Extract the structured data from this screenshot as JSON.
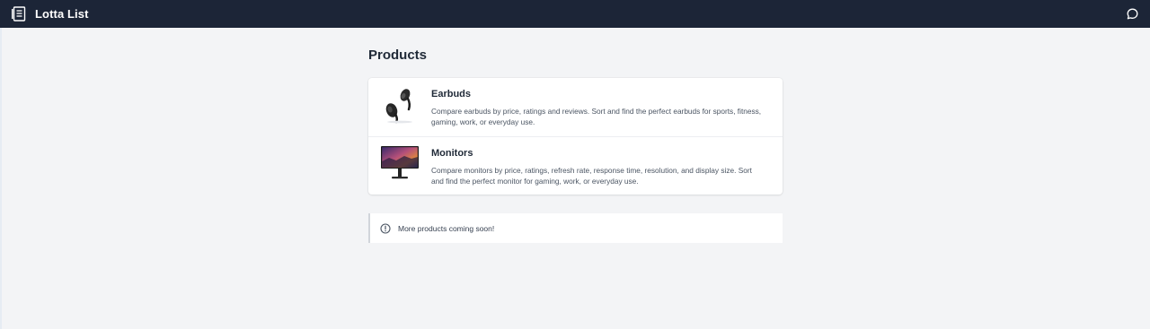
{
  "app": {
    "title": "Lotta List",
    "logo_icon": "list-document-icon",
    "chat_icon": "chat-bubble-icon"
  },
  "colors": {
    "topbar": "#1c2537",
    "background": "#f3f4f6",
    "card": "#ffffff"
  },
  "page": {
    "title": "Products"
  },
  "products": [
    {
      "title": "Earbuds",
      "description": "Compare earbuds by price, ratings and reviews. Sort and find the perfect earbuds for sports, fitness, gaming, work, or everyday use.",
      "image_icon": "earbuds-icon"
    },
    {
      "title": "Monitors",
      "description": "Compare monitors by price, ratings, refresh rate, response time, resolution, and display size. Sort and find the perfect monitor for gaming, work, or everyday use.",
      "image_icon": "monitor-icon"
    }
  ],
  "notice": {
    "text": "More products coming soon!",
    "icon": "info-circle-icon"
  }
}
